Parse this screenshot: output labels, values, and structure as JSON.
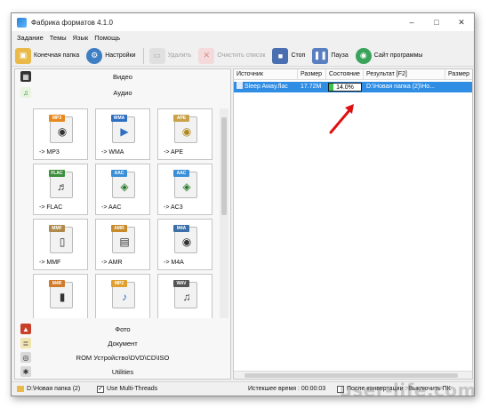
{
  "window": {
    "title": "Фабрика форматов 4.1.0",
    "controls": [
      "–",
      "□",
      "✕"
    ]
  },
  "menu": [
    "Задание",
    "Темы",
    "Язык",
    "Помощь"
  ],
  "toolbar": {
    "output_folder": "Конечная папка",
    "settings": "Настройки",
    "delete": "Удалить",
    "clear_list": "Очистить список",
    "stop": "Стоп",
    "pause": "Пауза",
    "website": "Сайт программы"
  },
  "categories": {
    "video": "Видео",
    "audio": "Аудио",
    "photo": "Фото",
    "document": "Документ",
    "rom": "ROM Устройство\\DVD\\CD\\ISO",
    "utilities": "Utilities"
  },
  "tiles": [
    {
      "badge": "MP3",
      "label": "-> MP3",
      "color": "#e68a1f",
      "icon": "speaker-icon"
    },
    {
      "badge": "WMA",
      "label": "-> WMA",
      "color": "#2e6fc2",
      "icon": "play-disc-icon"
    },
    {
      "badge": "APE",
      "label": "-> APE",
      "color": "#c9a24a",
      "icon": "speaker-icon"
    },
    {
      "badge": "FLAC",
      "label": "-> FLAC",
      "color": "#3d8f3d",
      "icon": "headphones-icon"
    },
    {
      "badge": "AAC",
      "label": "-> AAC",
      "color": "#3a8fd6",
      "icon": "speaker-icon"
    },
    {
      "badge": "AAC",
      "label": "-> AC3",
      "color": "#3a8fd6",
      "icon": "speaker-icon"
    },
    {
      "badge": "MMF",
      "label": "-> MMF",
      "color": "#b08a4a",
      "icon": "mobile-icon"
    },
    {
      "badge": "AMR",
      "label": "-> AMR",
      "color": "#c98a2a",
      "icon": "device-icon"
    },
    {
      "badge": "M4A",
      "label": "-> M4A",
      "color": "#3a6fa8",
      "icon": "speaker-icon"
    },
    {
      "badge": "M4R",
      "label": "",
      "color": "#d07a2a",
      "icon": "phone-icon"
    },
    {
      "badge": "MP2",
      "label": "",
      "color": "#e0a030",
      "icon": "note-icon"
    },
    {
      "badge": "WAV",
      "label": "",
      "color": "#555555",
      "icon": "notes-icon"
    }
  ],
  "columns": [
    "Источник",
    "Размер",
    "Состояние",
    "Результат [F2]",
    "Размер"
  ],
  "job": {
    "source": "Sleep Away.flac",
    "size": "17.72M",
    "progress_text": "14.0%",
    "progress": 0.14,
    "result": "D:\\Новая папка (2)\\Но..."
  },
  "statusbar": {
    "folder": "D:\\Новая папка (2)",
    "multithreads_label": "Use Multi-Threads",
    "multithreads_checked": true,
    "elapsed_label": "Истекшее время : 00:00:03",
    "after_convert_label": "После конвертации : Выключить ПК"
  },
  "watermark": "user-life.com"
}
